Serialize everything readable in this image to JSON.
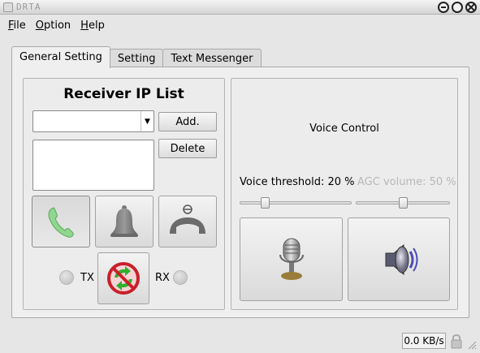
{
  "window": {
    "title": "DRTA"
  },
  "menu": [
    {
      "underline": "F",
      "rest": "ile"
    },
    {
      "underline": "O",
      "rest": "ption"
    },
    {
      "underline": "H",
      "rest": "elp"
    }
  ],
  "tabs": [
    "General Setting",
    "Setting",
    "Text Messenger"
  ],
  "receiver": {
    "title": "Receiver IP List",
    "ip_combo_value": "",
    "add_label": "Add.",
    "delete_label": "Delete"
  },
  "indicators": {
    "tx_label": "TX",
    "rx_label": "RX"
  },
  "voice": {
    "title": "Voice Control",
    "threshold_label": "Voice threshold: 20 %",
    "threshold_value": 20,
    "agc_label": "AGC volume: 50 %",
    "agc_value": 50
  },
  "status": {
    "rate": "0.0 KB/s"
  },
  "colors": {
    "call_green": "#7fcf7f",
    "sync_red": "#c8202a",
    "sync_green": "#2fb02f"
  }
}
